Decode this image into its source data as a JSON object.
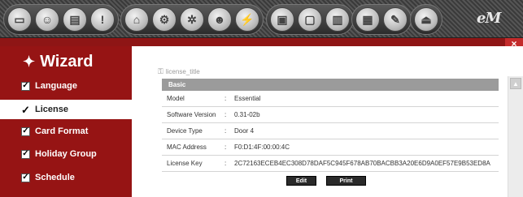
{
  "toolbar": {
    "groups": [
      {
        "buttons": [
          {
            "icon": "monitor-icon",
            "glyph": "▭"
          },
          {
            "icon": "user-icon",
            "glyph": "☺"
          },
          {
            "icon": "document-icon",
            "glyph": "▤"
          },
          {
            "icon": "alert-icon",
            "glyph": "!"
          }
        ]
      },
      {
        "buttons": [
          {
            "icon": "door-icon",
            "glyph": "⌂"
          },
          {
            "icon": "door-config-icon",
            "glyph": "⚙"
          },
          {
            "icon": "settings-icon",
            "glyph": "✲"
          },
          {
            "icon": "person-settings-icon",
            "glyph": "☻"
          },
          {
            "icon": "network-icon",
            "glyph": "⚡"
          }
        ]
      },
      {
        "buttons": [
          {
            "icon": "save-icon",
            "glyph": "▣"
          },
          {
            "icon": "page-icon",
            "glyph": "▢"
          },
          {
            "icon": "chart-icon",
            "glyph": "▥"
          }
        ]
      },
      {
        "buttons": [
          {
            "icon": "grid-icon",
            "glyph": "▦"
          },
          {
            "icon": "tools-icon",
            "glyph": "✎"
          }
        ]
      },
      {
        "buttons": [
          {
            "icon": "exit-icon",
            "glyph": "⏏"
          }
        ]
      }
    ],
    "logo": "eM"
  },
  "close_glyph": "×",
  "sidebar": {
    "title": "Wizard",
    "items": [
      {
        "label": "Language",
        "active": false,
        "mark": "✓"
      },
      {
        "label": "License",
        "active": true,
        "mark": "✓"
      },
      {
        "label": "Card Format",
        "active": false,
        "mark": "✓"
      },
      {
        "label": "Holiday Group",
        "active": false,
        "mark": "✓"
      },
      {
        "label": "Schedule",
        "active": false,
        "mark": "✓"
      }
    ]
  },
  "main": {
    "page_title": "license_title",
    "section": "Basic",
    "rows": [
      {
        "label": "Model",
        "colon": ":",
        "value": "Essential"
      },
      {
        "label": "Software Version",
        "colon": ":",
        "value": "0.31-02b"
      },
      {
        "label": "Device Type",
        "colon": ":",
        "value": "Door 4"
      },
      {
        "label": "MAC Address",
        "colon": ":",
        "value": "F0:D1:4F:00:00:4C"
      },
      {
        "label": "License Key",
        "colon": ":",
        "value": "2C72163ECEB4EC308D78DAF5C945F678AB70BACBB3A20E6D9A0EF57E9B53ED8A"
      }
    ],
    "edit_label": "Edit",
    "print_label": "Print"
  },
  "scroll_up_glyph": "▲"
}
